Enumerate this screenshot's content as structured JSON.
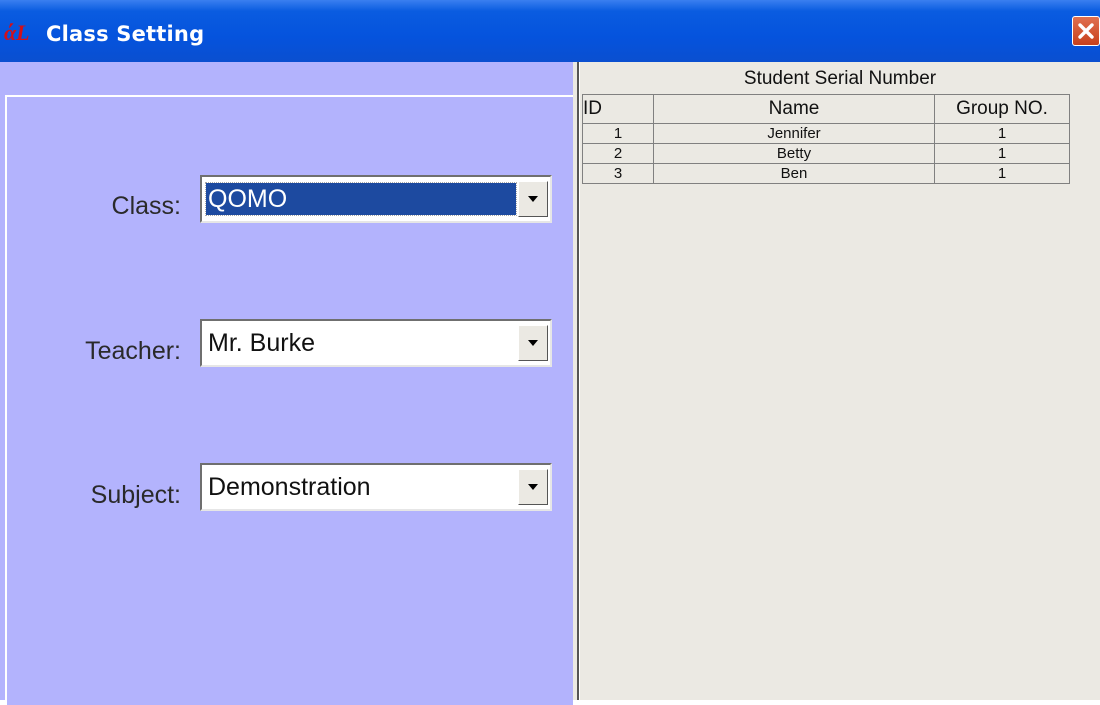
{
  "window": {
    "title": "Class Setting",
    "app_icon_text": "άL",
    "close_label": "close"
  },
  "form": {
    "class": {
      "label": "Class:",
      "value": "QOMO"
    },
    "teacher": {
      "label": "Teacher:",
      "value": "Mr. Burke"
    },
    "subject": {
      "label": "Subject:",
      "value": "Demonstration"
    }
  },
  "students": {
    "caption": "Student Serial Number",
    "columns": [
      "ID",
      "Name",
      "Group NO."
    ],
    "rows": [
      {
        "id": "1",
        "name": "Jennifer",
        "group": "1"
      },
      {
        "id": "2",
        "name": "Betty",
        "group": "1"
      },
      {
        "id": "3",
        "name": "Ben",
        "group": "1"
      }
    ]
  },
  "colors": {
    "titlebar": "#0553dd",
    "panel": "#b3b3fd",
    "selection": "#1d4aa0",
    "close": "#c8401c"
  }
}
